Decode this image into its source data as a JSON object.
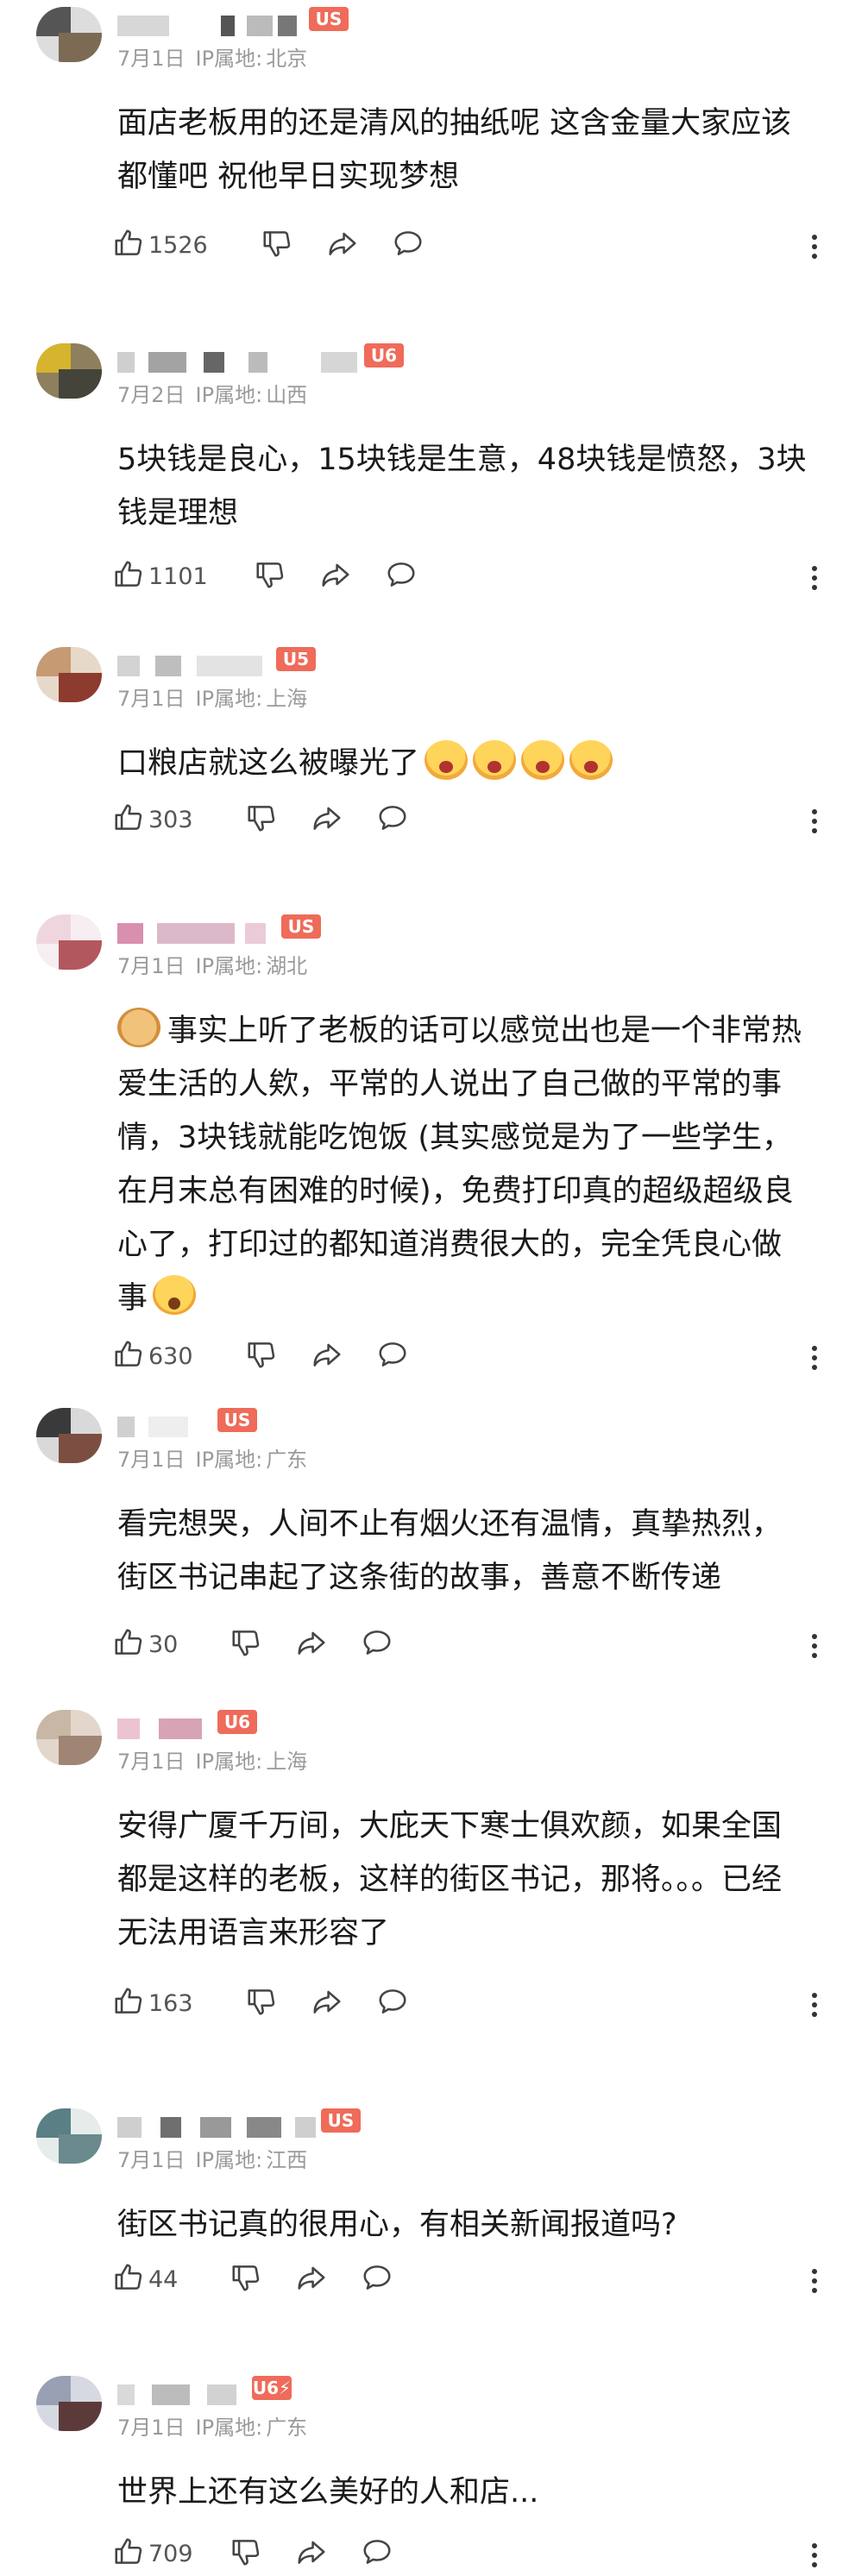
{
  "comments": [
    {
      "date": "7月1日",
      "ip_label": "IP属地:",
      "region": "北京",
      "level": "US",
      "text": "面店老板用的还是清风的抽纸呢 这含金量大家应该都懂吧 祝他早日实现梦想",
      "likes": "1526",
      "emojis": [],
      "lead_emoji": ""
    },
    {
      "date": "7月2日",
      "ip_label": "IP属地:",
      "region": "山西",
      "level": "U6",
      "text": "5块钱是良心，15块钱是生意，48块钱是愤怒，3块钱是理想",
      "likes": "1101",
      "emojis": [],
      "lead_emoji": ""
    },
    {
      "date": "7月1日",
      "ip_label": "IP属地:",
      "region": "上海",
      "level": "U5",
      "text": "口粮店就这么被曝光了",
      "likes": "303",
      "emojis": [
        "crying-face-icon",
        "crying-face-icon",
        "crying-face-icon",
        "crying-face-icon"
      ],
      "lead_emoji": ""
    },
    {
      "date": "7月1日",
      "ip_label": "IP属地:",
      "region": "湖北",
      "level": "US",
      "text": "事实上听了老板的话可以感觉出也是一个非常热爱生活的人欸，平常的人说出了自己做的平常的事情，3块钱就能吃饱饭 (其实感觉是为了一些学生，在月末总有困难的时候)，免费打印真的超级超级良心了，打印过的都知道消费很大的，完全凭良心做事",
      "likes": "630",
      "emojis": [
        "shocked-face-icon"
      ],
      "lead_emoji": "doge-face-icon"
    },
    {
      "date": "7月1日",
      "ip_label": "IP属地:",
      "region": "广东",
      "level": "US",
      "text": "看完想哭，人间不止有烟火还有温情，真挚热烈，街区书记串起了这条街的故事，善意不断传递",
      "likes": "30",
      "emojis": [],
      "lead_emoji": ""
    },
    {
      "date": "7月1日",
      "ip_label": "IP属地:",
      "region": "上海",
      "level": "U6",
      "text": "安得广厦千万间，大庇天下寒士俱欢颜，如果全国都是这样的老板，这样的街区书记，那将。。。已经无法用语言来形容了",
      "likes": "163",
      "emojis": [],
      "lead_emoji": ""
    },
    {
      "date": "7月1日",
      "ip_label": "IP属地:",
      "region": "江西",
      "level": "US",
      "text": "街区书记真的很用心，有相关新闻报道吗?",
      "likes": "44",
      "emojis": [],
      "lead_emoji": ""
    },
    {
      "date": "7月1日",
      "ip_label": "IP属地:",
      "region": "广东",
      "level": "U6⚡",
      "text": "世界上还有这么美好的人和店...",
      "likes": "709",
      "emojis": [],
      "lead_emoji": ""
    }
  ],
  "colors": {
    "level_badge": "#ef6b5a",
    "meta_text": "#9a9a9a",
    "body_text": "#1a1a1a"
  },
  "icons": [
    "thumbs-up-icon",
    "thumbs-down-icon",
    "share-icon",
    "comment-bubble-icon",
    "more-vertical-icon"
  ]
}
